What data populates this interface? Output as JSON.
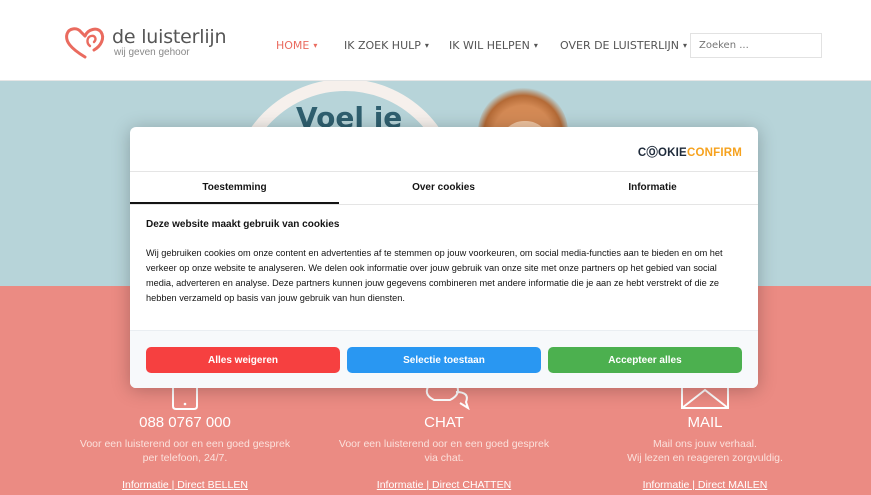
{
  "header": {
    "logo_main": "de luisterlijn",
    "logo_sub": "wij geven gehoor",
    "nav": [
      {
        "label": "HOME",
        "active": true
      },
      {
        "label": "IK ZOEK HULP",
        "active": false
      },
      {
        "label": "IK WIL HELPEN",
        "active": false
      },
      {
        "label": "OVER DE LUISTERLIJN",
        "active": false
      }
    ],
    "search_placeholder": "Zoeken ..."
  },
  "hero": {
    "title": "Voel je"
  },
  "contact": [
    {
      "icon": "phone-icon",
      "title": "088 0767 000",
      "desc_line1": "Voor een luisterend oor en een goed gesprek",
      "desc_line2": "per telefoon, 24/7.",
      "links": "Informatie | Direct BELLEN"
    },
    {
      "icon": "chat-icon",
      "title": "CHAT",
      "desc_line1": "Voor een luisterend oor en een goed gesprek",
      "desc_line2": "via chat.",
      "links": "Informatie | Direct CHATTEN"
    },
    {
      "icon": "mail-icon",
      "title": "MAIL",
      "desc_line1": "Mail ons jouw verhaal.",
      "desc_line2": "Wij lezen en reageren zorgvuldig.",
      "links": "Informatie | Direct MAILEN"
    }
  ],
  "cookie": {
    "brand_a": "CⓄOKIE",
    "brand_b": "CONFIRM",
    "tabs": [
      "Toestemming",
      "Over cookies",
      "Informatie"
    ],
    "heading": "Deze website maakt gebruik van cookies",
    "body": "Wij gebruiken cookies om onze content en advertenties af te stemmen op jouw voorkeuren, om social media-functies aan te bieden en om het verkeer op onze website te analyseren. We delen ook informatie over jouw gebruik van onze site met onze partners op het gebied van social media, adverteren en analyse. Deze partners kunnen jouw gegevens combineren met andere informatie die je aan ze hebt verstrekt of die ze hebben verzameld op basis van jouw gebruik van hun diensten.",
    "buttons": {
      "deny": "Alles weigeren",
      "select": "Selectie toestaan",
      "accept": "Accepteer alles"
    },
    "colors": {
      "deny": "#f64040",
      "select": "#2997f2",
      "accept": "#4cb04f",
      "brand_accent": "#f6a21e"
    }
  }
}
